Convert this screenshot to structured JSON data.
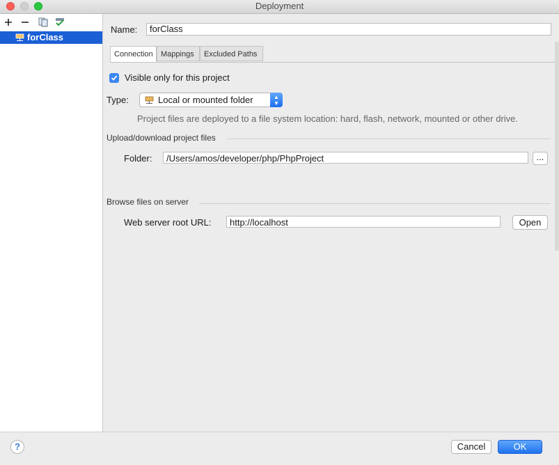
{
  "window": {
    "title": "Deployment"
  },
  "sidebar": {
    "toolbar": [
      {
        "name": "add-server-button",
        "glyph": "+"
      },
      {
        "name": "remove-server-button",
        "glyph": "−"
      },
      {
        "name": "copy-server-button",
        "glyph": "copy-icon"
      },
      {
        "name": "use-as-default-button",
        "glyph": "check-icon"
      }
    ],
    "items": [
      {
        "label": "forClass"
      }
    ]
  },
  "server": {
    "name_label": "Name:",
    "name_value": "forClass"
  },
  "tabs": [
    {
      "label": "Connection",
      "active": true
    },
    {
      "label": "Mappings",
      "active": false
    },
    {
      "label": "Excluded Paths",
      "active": false
    }
  ],
  "connection": {
    "visible_only_label": "Visible only for this project",
    "visible_only_checked": true,
    "type_label": "Type:",
    "type_value": "Local or mounted folder",
    "type_hint": "Project files are deployed to a file system location:  hard, flash, network, mounted or other drive.",
    "upload_group": "Upload/download project files",
    "folder_label": "Folder:",
    "folder_value": "/Users/amos/developer/php/PhpProject",
    "browse_button": "...",
    "browse_group": "Browse files on server",
    "web_root_label": "Web server root URL:",
    "web_root_value": "http://localhost",
    "open_button": "Open"
  },
  "footer": {
    "help": "?",
    "cancel": "Cancel",
    "ok": "OK"
  },
  "colors": {
    "accent": "#1f72ee",
    "selection": "#1a5fd6",
    "checkbox": "#3a86f3"
  }
}
